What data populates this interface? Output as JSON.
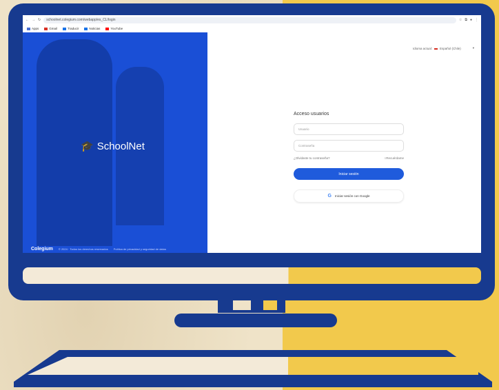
{
  "browser": {
    "url": "schoolnet.colegium.com/webapp/es_CL/login",
    "bookmarks": [
      {
        "label": "Apps",
        "color": "#4a6fd1"
      },
      {
        "label": "Gmail",
        "color": "#d93025"
      },
      {
        "label": "Traducir",
        "color": "#1a73e8"
      },
      {
        "label": "Noticias",
        "color": "#1a73e8"
      },
      {
        "label": "YouTube",
        "color": "#ff0000"
      }
    ]
  },
  "hero": {
    "brand_name": "SchoolNet",
    "footer_logo": "Colegium",
    "copyright": "© 2024 · Todos los derechos reservados",
    "privacy_link": "Política de privacidad y seguridad de datos"
  },
  "login": {
    "language_label": "Idioma actual:",
    "language_value": "Español (Chile)",
    "title": "Acceso usuarios",
    "username_placeholder": "Usuario",
    "password_placeholder": "Contraseña",
    "forgot_password": "¿Olvidaste tu contraseña?",
    "remember_me": "Recuérdame",
    "login_button": "Iniciar sesión",
    "google_button": "Iniciar sesión con Google"
  },
  "colors": {
    "accent": "#1f5bdc",
    "monitor": "#173a8f",
    "yellow": "#f2c94c"
  }
}
